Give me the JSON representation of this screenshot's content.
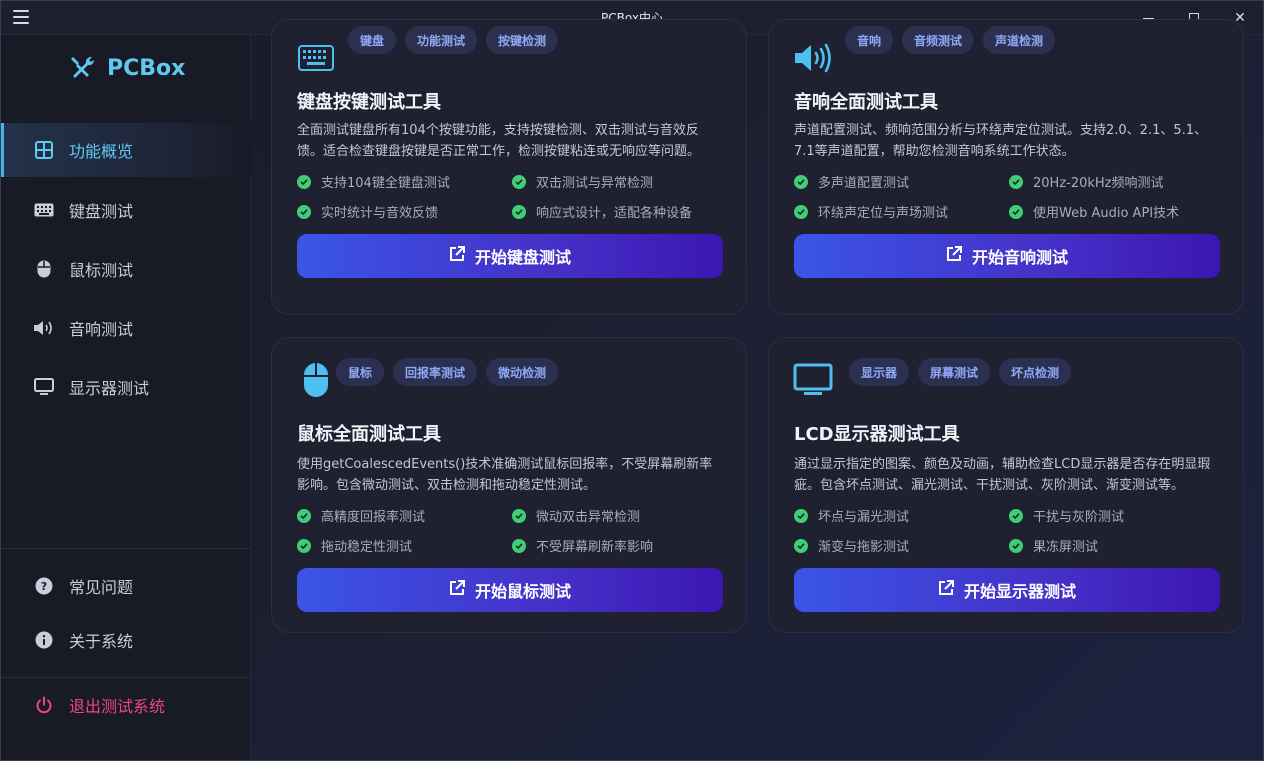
{
  "window": {
    "title": "PCBox中心"
  },
  "sidebar": {
    "brand": "PCBox",
    "items": [
      {
        "label": "功能概览",
        "icon": "grid-icon"
      },
      {
        "label": "键盘测试",
        "icon": "keyboard-icon"
      },
      {
        "label": "鼠标测试",
        "icon": "mouse-icon"
      },
      {
        "label": "音响测试",
        "icon": "speaker-icon"
      },
      {
        "label": "显示器测试",
        "icon": "monitor-icon"
      }
    ],
    "bottom": [
      {
        "label": "常见问题",
        "icon": "question-icon"
      },
      {
        "label": "关于系统",
        "icon": "info-icon"
      }
    ],
    "logout": {
      "label": "退出测试系统",
      "icon": "power-icon"
    }
  },
  "cards": [
    {
      "icon": "keyboard-icon",
      "tags": [
        "键盘",
        "功能测试",
        "按键检测"
      ],
      "title": "键盘按键测试工具",
      "desc": "全面测试键盘所有104个按键功能，支持按键检测、双击测试与音效反馈。适合检查键盘按键是否正常工作，检测按键粘连或无响应等问题。",
      "features": [
        "支持104键全键盘测试",
        "双击测试与异常检测",
        "实时统计与音效反馈",
        "响应式设计，适配各种设备"
      ],
      "button": "开始键盘测试"
    },
    {
      "icon": "speaker-icon",
      "tags": [
        "音响",
        "音频测试",
        "声道检测"
      ],
      "title": "音响全面测试工具",
      "desc": "声道配置测试、频响范围分析与环绕声定位测试。支持2.0、2.1、5.1、7.1等声道配置，帮助您检测音响系统工作状态。",
      "features": [
        "多声道配置测试",
        "20Hz-20kHz频响测试",
        "环绕声定位与声场测试",
        "使用Web Audio API技术"
      ],
      "button": "开始音响测试"
    },
    {
      "icon": "mouse-icon",
      "tags": [
        "鼠标",
        "回报率测试",
        "微动检测"
      ],
      "title": "鼠标全面测试工具",
      "desc": "使用getCoalescedEvents()技术准确测试鼠标回报率，不受屏幕刷新率影响。包含微动测试、双击检测和拖动稳定性测试。",
      "features": [
        "高精度回报率测试",
        "微动双击异常检测",
        "拖动稳定性测试",
        "不受屏幕刷新率影响"
      ],
      "button": "开始鼠标测试"
    },
    {
      "icon": "monitor-icon",
      "tags": [
        "显示器",
        "屏幕测试",
        "坏点检测"
      ],
      "title": "LCD显示器测试工具",
      "desc": "通过显示指定的图案、颜色及动画，辅助检查LCD显示器是否存在明显瑕疵。包含坏点测试、漏光测试、干扰测试、灰阶测试、渐变测试等。",
      "features": [
        "坏点与漏光测试",
        "干扰与灰阶测试",
        "渐变与拖影测试",
        "果冻屏测试"
      ],
      "button": "开始显示器测试"
    }
  ],
  "colors": {
    "accent": "#5fc9f0",
    "check": "#3ecf74",
    "danger": "#f0477a",
    "button_from": "#3a55e6",
    "button_to": "#3c16b3"
  }
}
